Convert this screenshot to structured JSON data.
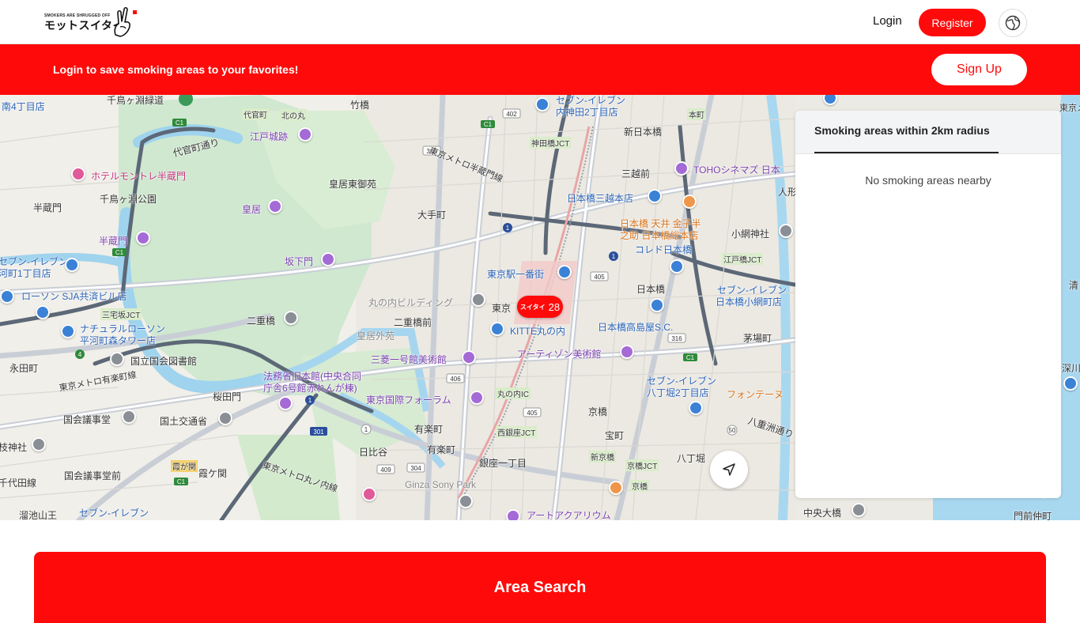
{
  "header": {
    "logo": {
      "tagline": "SMOKERS ARE SHRUGGED OFF",
      "name": "モットスイタイ"
    },
    "login_label": "Login",
    "register_label": "Register",
    "language_icon": "globe-icon"
  },
  "banner": {
    "message": "Login to save smoking areas to your favorites!",
    "signup_label": "Sign Up"
  },
  "map": {
    "cluster": {
      "brand": "スイタイ",
      "count": "28"
    },
    "locate_icon": "navigation-arrow-icon",
    "labels": {
      "l1": "千鳥ヶ淵緑道",
      "l2": "南4丁目店",
      "l3": "代官町",
      "l4": "北の丸",
      "l5": "竹橋",
      "l6": "セブン-イレブン",
      "l7": "内神田2丁目店",
      "l8": "新日本橋",
      "l9": "本町",
      "l10": "江戸城跡",
      "l11": "代官町通り",
      "l12": "神田橋JCT",
      "l13": "三越前",
      "l14": "TOHOシネマズ 日本",
      "l15": "ホテルモントレ半蔵門",
      "l16": "皇居東御苑",
      "l17": "日本橋三越本店",
      "l18": "人形",
      "l19": "千鳥ヶ淵公園",
      "l20": "半蔵門",
      "l21": "皇居",
      "l22": "大手町",
      "l23": "日本橋 天井 金子半",
      "l24": "之助 日本橋総本店",
      "l25": "小網神社",
      "l26": "半蔵門",
      "l27": "コレド日本橋",
      "l28": "江戸橋JCT",
      "l29": "坂下門",
      "l30": "セブン-イレブン",
      "l31": "河町1丁目店",
      "l32": "東京駅一番街",
      "l33": "日本橋",
      "l34": "セブン-イレブン",
      "l35": "日本橋小網町店",
      "l36": "ローソン SJA共済ビル店",
      "l37": "丸の内ビルディング",
      "l38": "東京",
      "l39": "三宅坂JCT",
      "l40": "二重橋",
      "l41": "二重橋前",
      "l42": "KITTE丸の内",
      "l43": "日本橋高島屋S.C.",
      "l44": "ナチュラルローソン",
      "l45": "平河町森タワー店",
      "l46": "皇居外苑",
      "l47": "茅場町",
      "l48": "国立国会図書館",
      "l49": "三菱一号館美術館",
      "l50": "アーティゾン美術館",
      "l51": "永田町",
      "l52": "法務省旧本館(中央合同",
      "l53": "庁舎6号館赤れんが棟)",
      "l54": "セブン-イレブン",
      "l55": "八丁堀2丁目店",
      "l56": "東京メトロ有楽町線",
      "l57": "丸の内IC",
      "l58": "フォンテーヌ",
      "l59": "桜田門",
      "l60": "東京国際フォーラム",
      "l61": "京橋",
      "l62": "国会議事堂",
      "l63": "国土交通省",
      "l64": "有楽町",
      "l65": "西銀座JCT",
      "l66": "宝町",
      "l67": "八重洲通り",
      "l68": "枝神社",
      "l69": "日比谷",
      "l70": "有楽町",
      "l71": "新京橋",
      "l72": "八丁堀",
      "l73": "霞が関",
      "l74": "霞ケ関",
      "l75": "銀座一丁目",
      "l76": "京橋JCT",
      "l77": "国会議事堂前",
      "l78": "東京メトロ丸ノ内線",
      "l79": "Ginza Sony Park",
      "l80": "千代田線",
      "l81": "京橋",
      "l82": "溜池山王",
      "l83": "セブン-イレブン",
      "l84": "アートアクアリウム",
      "l85": "中央大橋",
      "l86": "門前仲町",
      "l87": "東京メトロ半蔵門線",
      "l88": "清",
      "l89": "深川",
      "l90": "東京メトロ東西線"
    }
  },
  "panel": {
    "tab_label": "Smoking areas within 2km radius",
    "empty_message": "No smoking areas nearby"
  },
  "area_search": {
    "title": "Area Search"
  }
}
